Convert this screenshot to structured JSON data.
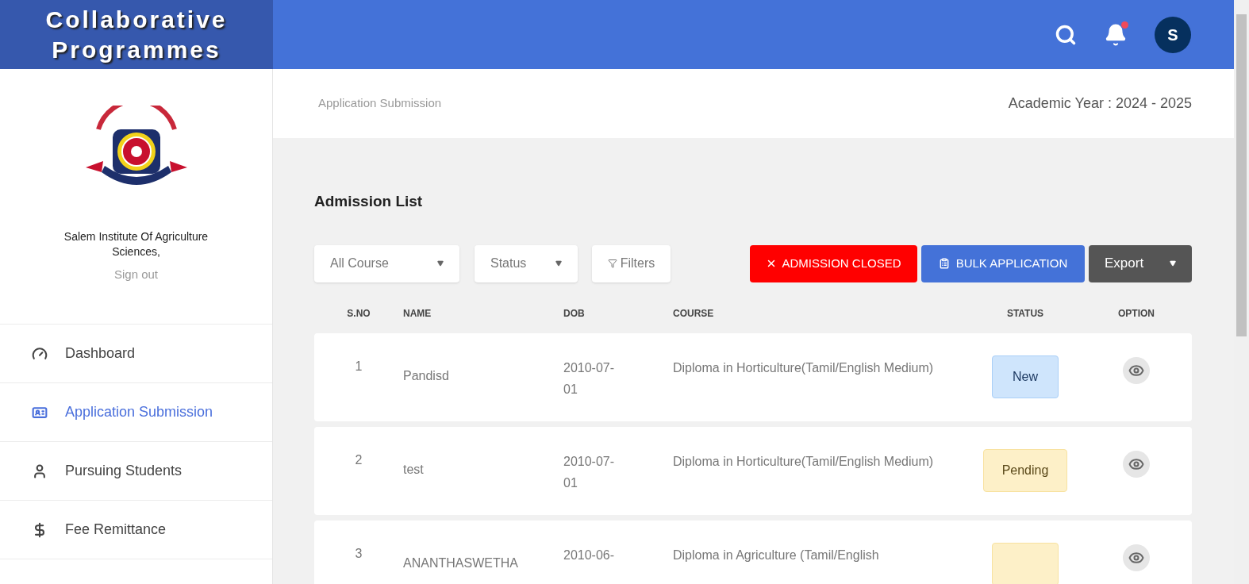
{
  "header": {
    "title_line_1": "Collaborative",
    "title_line_2": "Programmes",
    "notifications_unread": true,
    "avatar_letter": "S"
  },
  "sidebar": {
    "institution": "Salem Institute Of Agriculture Sciences,",
    "sign_out": "Sign out",
    "items": [
      {
        "label": "Dashboard",
        "kind": "gauge",
        "selected": false
      },
      {
        "label": "Application Submission",
        "kind": "idcard",
        "selected": true
      },
      {
        "label": "Pursuing Students",
        "kind": "user",
        "selected": false
      },
      {
        "label": "Fee Remittance",
        "kind": "dollar",
        "selected": false
      }
    ]
  },
  "page_bar": {
    "breadcrumb": "Application Submission",
    "academic_year": "Academic Year : 2024 - 2025"
  },
  "section_title": "Admission List",
  "filters": {
    "course": "All Course",
    "status": "Status",
    "filters_button": "Filters"
  },
  "actions": {
    "admission_closed": "ADMISSION CLOSED",
    "bulk_application": "BULK APPLICATION",
    "export": "Export"
  },
  "table": {
    "columns": [
      "S.NO",
      "NAME",
      "DOB",
      "COURSE",
      "STATUS",
      "OPTION"
    ],
    "rows": [
      {
        "sno": "1",
        "name": "Pandisd",
        "dob": "2010-07-01",
        "course": "Diploma in Horticulture(Tamil/English Medium)",
        "status": {
          "kind": "new",
          "label": "New"
        }
      },
      {
        "sno": "2",
        "name": "test",
        "dob": "2010-07-01",
        "course": "Diploma in Horticulture(Tamil/English Medium)",
        "status": {
          "kind": "pending",
          "label": "Pending"
        }
      },
      {
        "sno": "3",
        "name": "ANANTHASWETHA",
        "dob": "2010-06-",
        "course": "Diploma in Agriculture (Tamil/English",
        "status": {
          "kind": "pending"
        }
      }
    ]
  }
}
